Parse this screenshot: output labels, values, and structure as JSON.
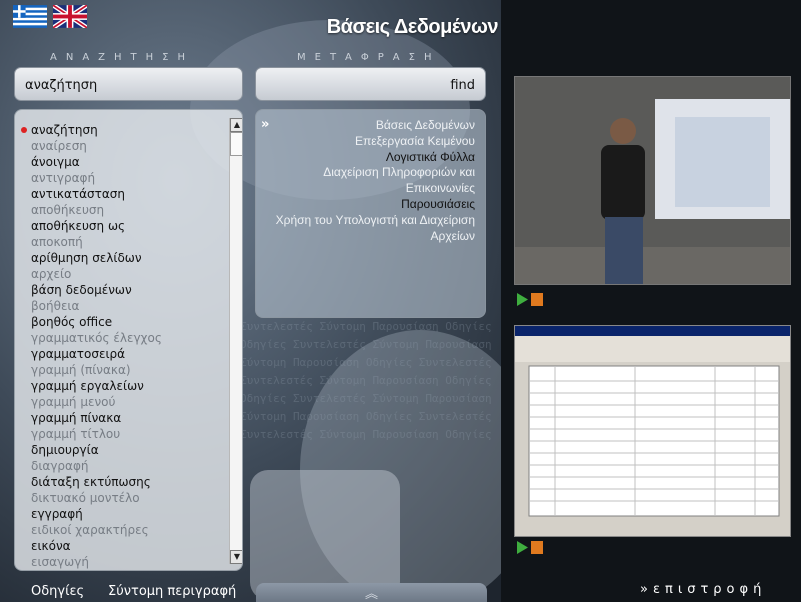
{
  "header": {
    "title": "Βάσεις Δεδομένων"
  },
  "languages": [
    {
      "name": "greek-flag-icon"
    },
    {
      "name": "uk-flag-icon"
    }
  ],
  "search": {
    "label": "ΑΝΑΖΗΤΗΣΗ",
    "value": "αναζήτηση",
    "words": [
      {
        "text": "αναζήτηση",
        "state": "selected"
      },
      {
        "text": "αναίρεση",
        "state": "normal"
      },
      {
        "text": "άνοιγμα",
        "state": "dark"
      },
      {
        "text": "αντιγραφή",
        "state": "normal"
      },
      {
        "text": "αντικατάσταση",
        "state": "dark"
      },
      {
        "text": "αποθήκευση",
        "state": "normal"
      },
      {
        "text": "αποθήκευση ως",
        "state": "dark"
      },
      {
        "text": "αποκοπή",
        "state": "normal"
      },
      {
        "text": "αρίθμηση σελίδων",
        "state": "dark"
      },
      {
        "text": "αρχείο",
        "state": "normal"
      },
      {
        "text": "βάση δεδομένων",
        "state": "dark"
      },
      {
        "text": "βοήθεια",
        "state": "normal"
      },
      {
        "text": "βοηθός office",
        "state": "dark"
      },
      {
        "text": "γραμματικός έλεγχος",
        "state": "normal"
      },
      {
        "text": "γραμματοσειρά",
        "state": "dark"
      },
      {
        "text": "γραμμή (πίνακα)",
        "state": "normal"
      },
      {
        "text": "γραμμή εργαλείων",
        "state": "dark"
      },
      {
        "text": "γραμμή μενού",
        "state": "normal"
      },
      {
        "text": "γραμμή πίνακα",
        "state": "dark"
      },
      {
        "text": "γραμμή τίτλου",
        "state": "normal"
      },
      {
        "text": "δημιουργία",
        "state": "dark"
      },
      {
        "text": "διαγραφή",
        "state": "normal"
      },
      {
        "text": "διάταξη εκτύπωσης",
        "state": "dark"
      },
      {
        "text": "δικτυακό μοντέλο",
        "state": "normal"
      },
      {
        "text": "εγγραφή",
        "state": "dark"
      },
      {
        "text": "ειδικοί χαρακτήρες",
        "state": "normal"
      },
      {
        "text": "εικόνα",
        "state": "dark"
      },
      {
        "text": "εισαγωγή",
        "state": "normal"
      }
    ]
  },
  "translation": {
    "label": "ΜΕΤΑΦΡΑΣΗ",
    "value": "find",
    "items": [
      {
        "text": "Βάσεις Δεδομένων",
        "state": "normal"
      },
      {
        "text": "Επεξεργασία Κειμένου",
        "state": "normal"
      },
      {
        "text": "Λογιστικά Φύλλα",
        "state": "dark"
      },
      {
        "text": "Διαχείριση Πληροφοριών και Επικοινωνίες",
        "state": "normal"
      },
      {
        "text": "Παρουσιάσεις",
        "state": "dark"
      },
      {
        "text": "Χρήση του Υπολογιστή και Διαχείριση Αρχείων",
        "state": "normal"
      }
    ]
  },
  "footer": {
    "help": "Οδηγίες",
    "description": "Σύντομη περιγραφή",
    "back": "επιστροφή"
  },
  "colors": {
    "accent_red": "#d22222",
    "panel_bg": "#e8ecf0",
    "dark_bg": "#101418"
  }
}
